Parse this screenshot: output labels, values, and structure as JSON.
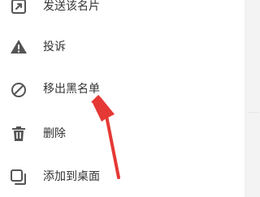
{
  "menu": {
    "items": [
      {
        "id": "share-card",
        "label": "发送该名片",
        "icon": "share-icon"
      },
      {
        "id": "report",
        "label": "投诉",
        "icon": "warning-icon"
      },
      {
        "id": "remove-blacklist",
        "label": "移出黑名单",
        "icon": "block-icon"
      },
      {
        "id": "delete",
        "label": "删除",
        "icon": "trash-icon"
      },
      {
        "id": "add-desktop",
        "label": "添加到桌面",
        "icon": "add-to-desktop-icon"
      }
    ]
  },
  "colors": {
    "text": "#333333",
    "icon": "#555555",
    "arrow": "#e53935",
    "side_panel": "#f5f5f5"
  }
}
